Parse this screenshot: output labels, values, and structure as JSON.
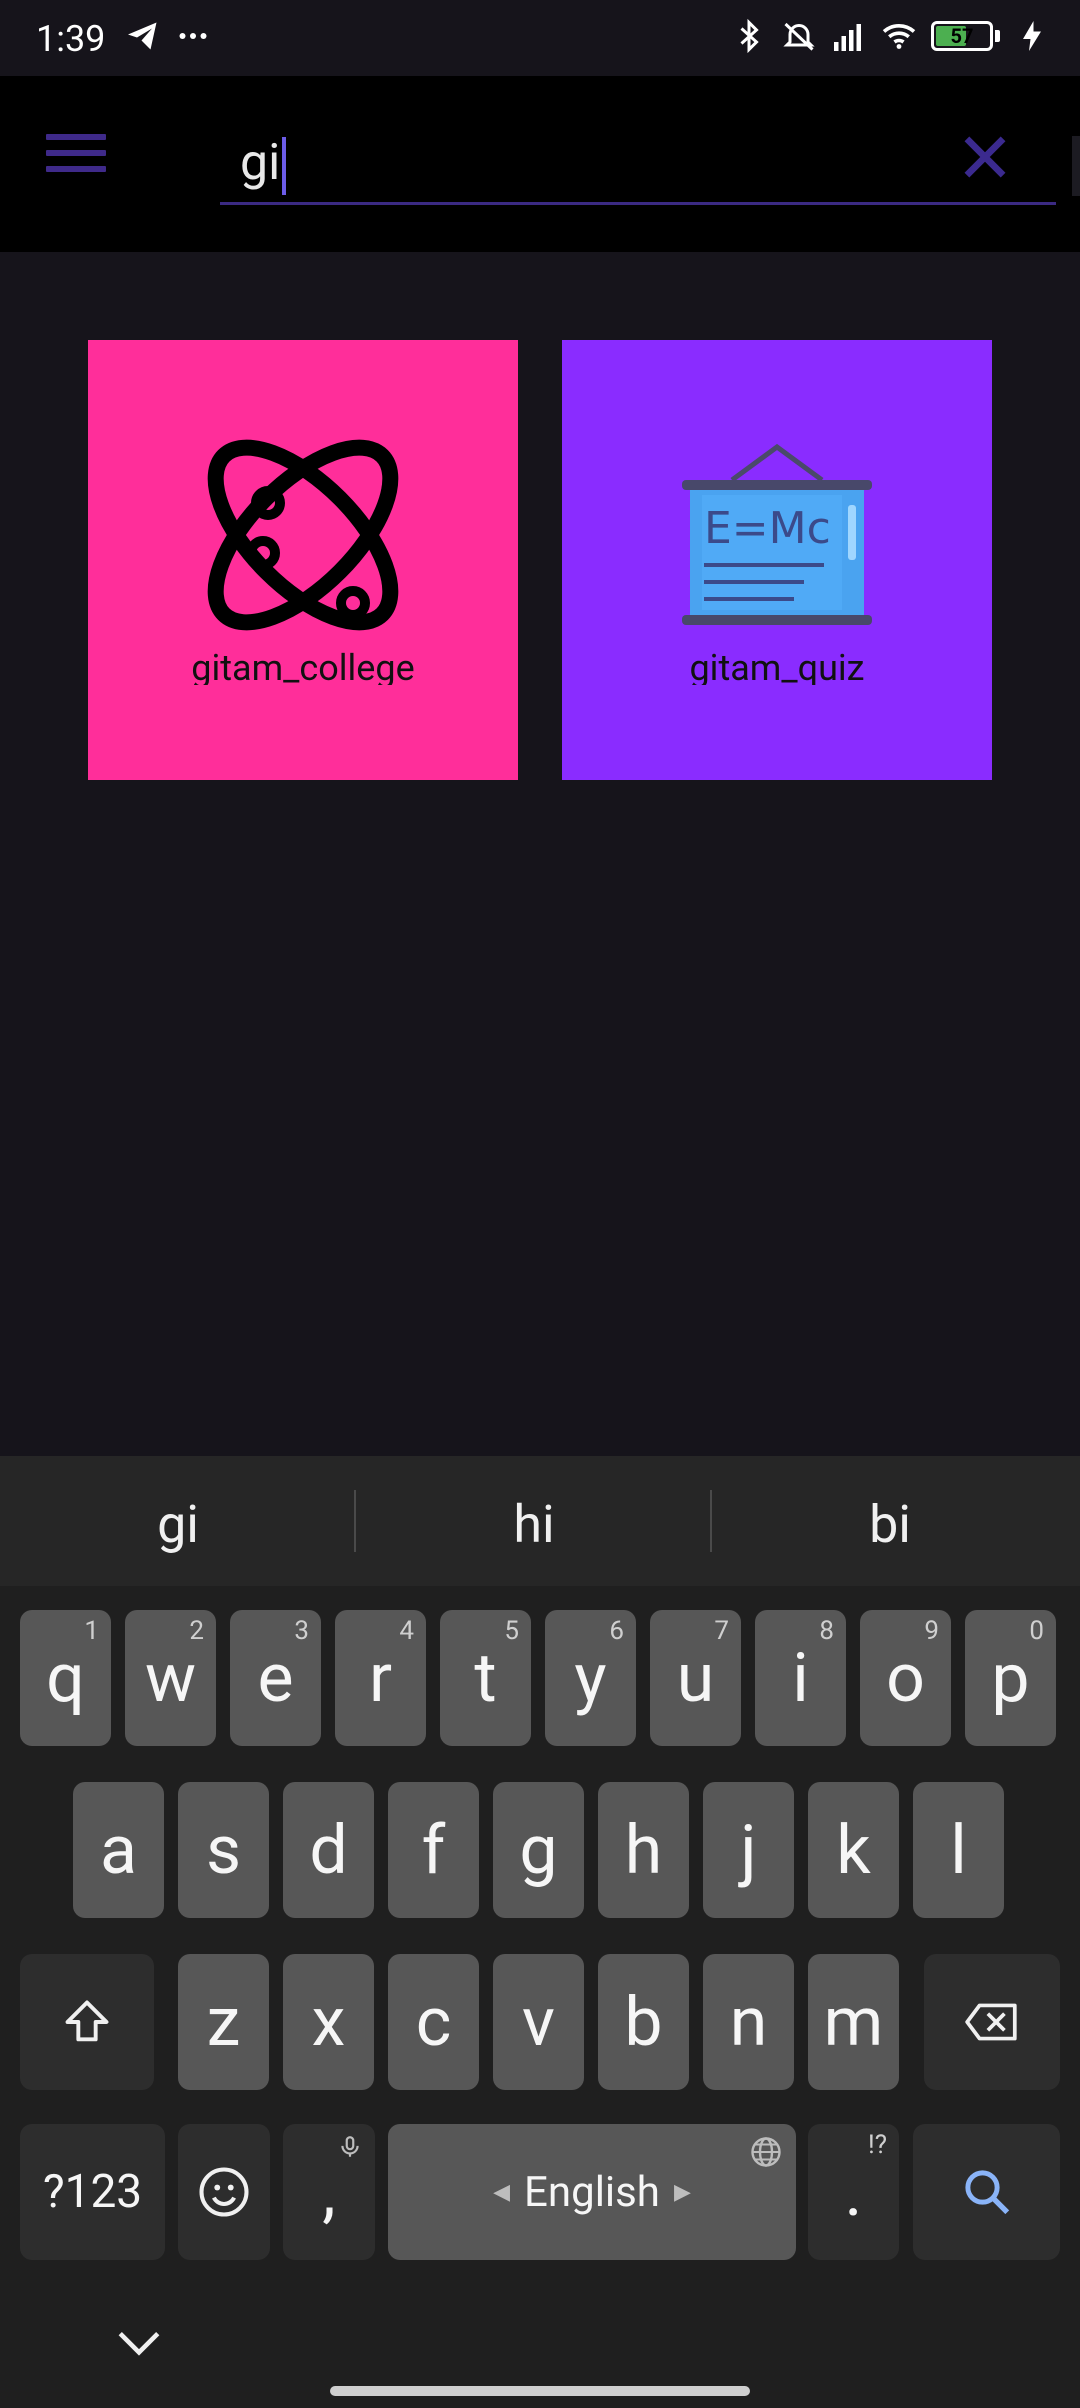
{
  "status_bar": {
    "time": "1:39",
    "left_icons": [
      "telegram-icon",
      "more-dots-icon"
    ],
    "right_icons": [
      "bluetooth-icon",
      "muted-bell-icon",
      "signal-icon",
      "wifi-icon",
      "battery-icon",
      "charging-icon"
    ],
    "battery_level": "57"
  },
  "app_bar": {
    "menu_icon": "hamburger-menu-icon",
    "search_value": "gi",
    "clear_icon": "close-icon"
  },
  "results": [
    {
      "label": "gitam_college",
      "color": "#ff2e9a",
      "icon": "atom-icon"
    },
    {
      "label": "gitam_quiz",
      "color": "#8a2cff",
      "icon": "blackboard-icon"
    }
  ],
  "keyboard": {
    "suggestions": [
      "gi",
      "hi",
      "bi"
    ],
    "row1": [
      {
        "key": "q",
        "hint": "1"
      },
      {
        "key": "w",
        "hint": "2"
      },
      {
        "key": "e",
        "hint": "3"
      },
      {
        "key": "r",
        "hint": "4"
      },
      {
        "key": "t",
        "hint": "5"
      },
      {
        "key": "y",
        "hint": "6"
      },
      {
        "key": "u",
        "hint": "7"
      },
      {
        "key": "i",
        "hint": "8"
      },
      {
        "key": "o",
        "hint": "9"
      },
      {
        "key": "p",
        "hint": "0"
      }
    ],
    "row2": [
      "a",
      "s",
      "d",
      "f",
      "g",
      "h",
      "j",
      "k",
      "l"
    ],
    "row3": [
      "z",
      "x",
      "c",
      "v",
      "b",
      "n",
      "m"
    ],
    "symbols_label": "?123",
    "comma_label": ",",
    "space_label": "English",
    "period_label": ".",
    "period_hint": "!?"
  },
  "colors": {
    "background": "#16141b",
    "appbar": "#000000",
    "accent": "#3f2a8a",
    "key": "#575757",
    "key_dark": "#2d2d2d"
  }
}
